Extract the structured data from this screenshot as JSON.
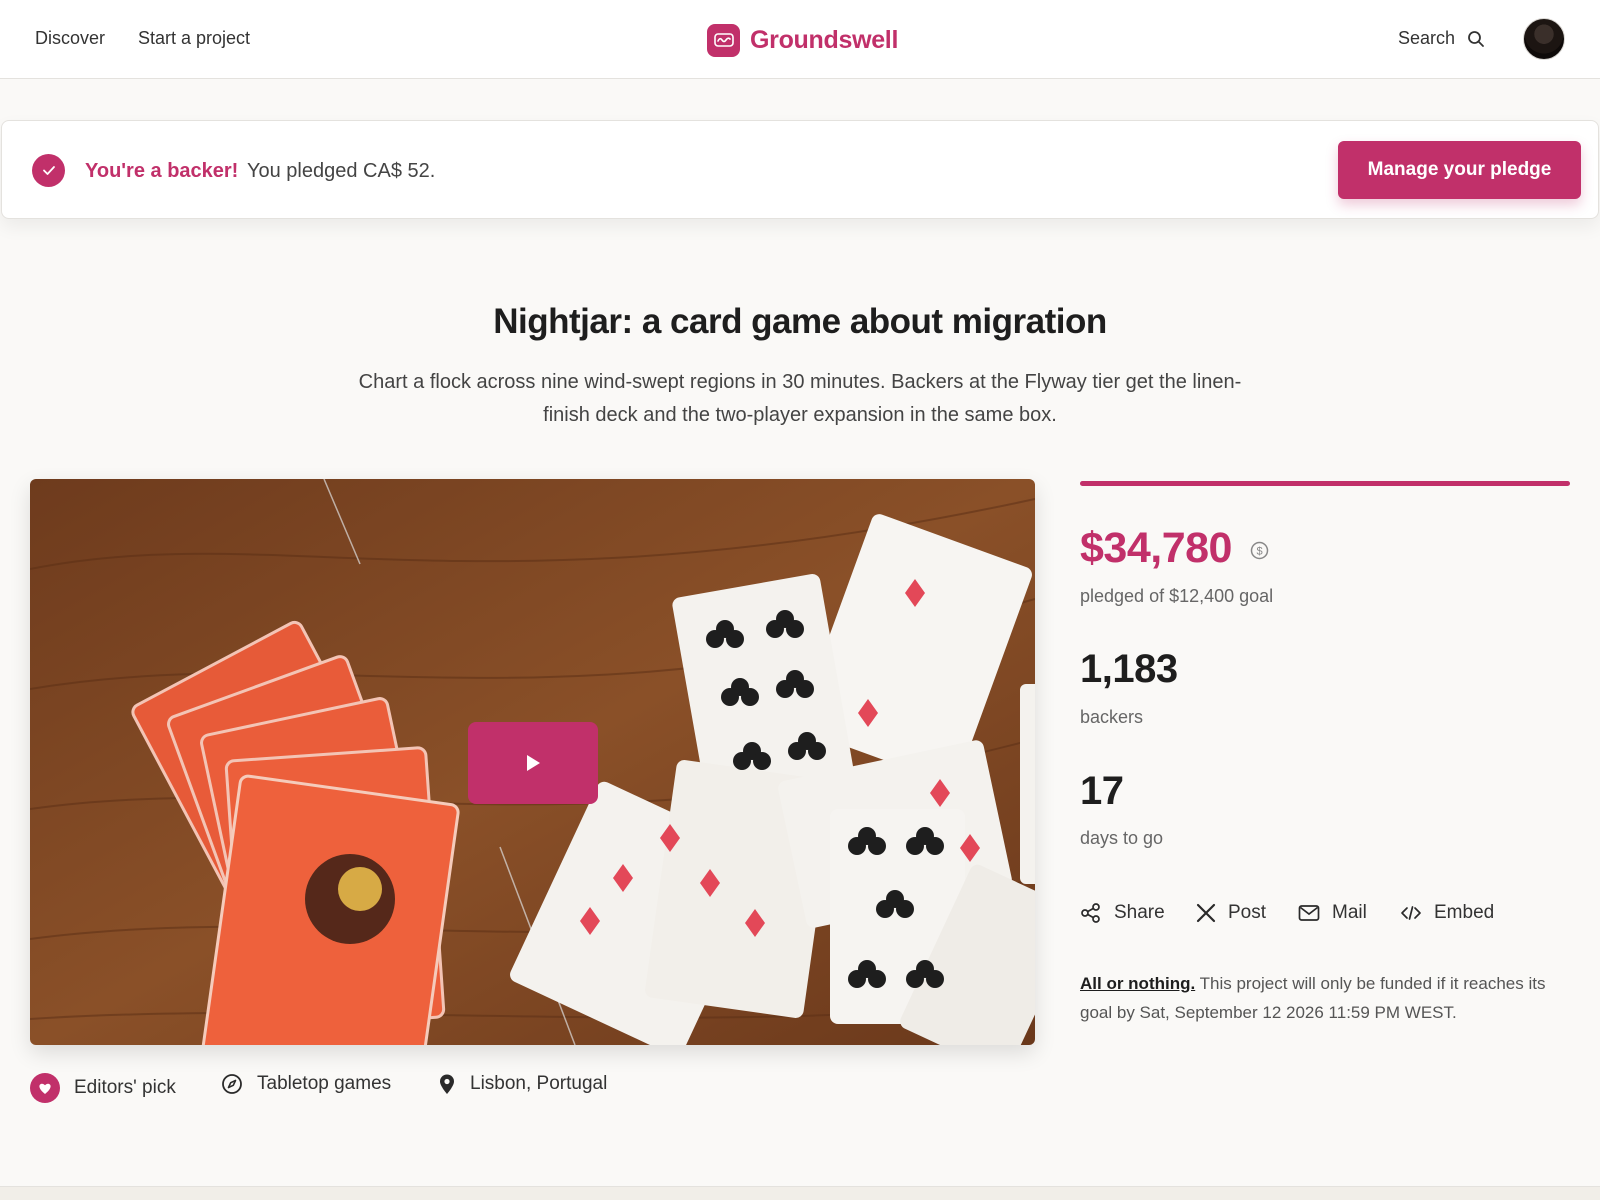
{
  "header": {
    "nav": [
      "Discover",
      "Start a project"
    ],
    "brand": "Groundswell",
    "search_label": "Search"
  },
  "banner": {
    "strong": "You're a backer!",
    "text": "You pledged CA$ 52.",
    "button": "Manage your pledge"
  },
  "project": {
    "title": "Nightjar: a card game about migration",
    "subtitle": "Chart a flock across nine wind-swept regions in 30 minutes. Backers at the Flyway tier get the linen-finish deck and the two-player expansion in the same box."
  },
  "tags": [
    {
      "label": "Editors' pick",
      "icon": "heart-badge-icon"
    },
    {
      "label": "Tabletop games",
      "icon": "compass-icon"
    },
    {
      "label": "Lisbon, Portugal",
      "icon": "location-pin-icon"
    }
  ],
  "stats": {
    "progress_fraction": 1.0,
    "pledged": "$34,780",
    "pledged_label": "pledged of $12,400 goal",
    "backers": "1,183",
    "backers_label": "backers",
    "days": "17",
    "days_label": "days to go"
  },
  "share": [
    {
      "label": "Share",
      "icon": "share-icon"
    },
    {
      "label": "Post",
      "icon": "x-logo-icon"
    },
    {
      "label": "Mail",
      "icon": "mail-icon"
    },
    {
      "label": "Embed",
      "icon": "embed-code-icon"
    }
  ],
  "funding_note": {
    "link": "All or nothing.",
    "text": "This project will only be funded if it reaches its goal by Sat, September 12 2026 11:59 PM WEST."
  },
  "colors": {
    "accent": "#c1306a",
    "background": "#faf9f7",
    "wood": "#7a4523"
  }
}
